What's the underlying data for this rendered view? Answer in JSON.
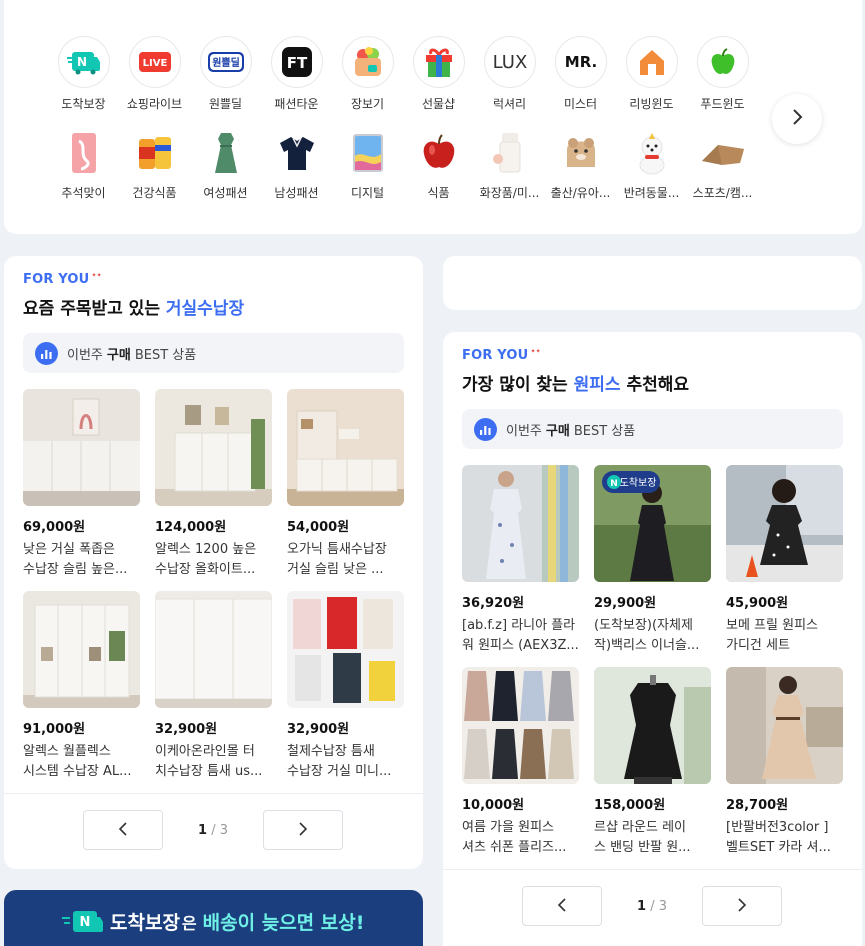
{
  "categories": {
    "row1": [
      {
        "label": "도착보장",
        "icon": "delivery-truck-icon"
      },
      {
        "label": "쇼핑라이브",
        "icon": "live-icon",
        "badge": "LIVE"
      },
      {
        "label": "원쁠딜",
        "icon": "one-plus-deal-icon",
        "badge": "원쁠딜"
      },
      {
        "label": "패션타운",
        "icon": "fashion-town-icon",
        "badge": "FT"
      },
      {
        "label": "장보기",
        "icon": "grocery-bag-icon"
      },
      {
        "label": "선물샵",
        "icon": "gift-icon"
      },
      {
        "label": "럭셔리",
        "icon": "luxury-icon",
        "badge": "LUX"
      },
      {
        "label": "미스터",
        "icon": "mister-icon",
        "badge": "MR."
      },
      {
        "label": "리빙윈도",
        "icon": "house-icon"
      },
      {
        "label": "푸드윈도",
        "icon": "apple-icon"
      }
    ],
    "row2": [
      {
        "label": "추석맞이",
        "icon": "chuseok-icon"
      },
      {
        "label": "건강식품",
        "icon": "health-food-icon"
      },
      {
        "label": "여성패션",
        "icon": "dress-icon"
      },
      {
        "label": "남성패션",
        "icon": "polo-shirt-icon"
      },
      {
        "label": "디지털",
        "icon": "tablet-icon"
      },
      {
        "label": "식품",
        "icon": "apple-food-icon"
      },
      {
        "label": "화장품/미...",
        "icon": "cosmetics-icon"
      },
      {
        "label": "출산/유아...",
        "icon": "baby-icon"
      },
      {
        "label": "반려동물...",
        "icon": "pet-icon"
      },
      {
        "label": "스포츠/캠...",
        "icon": "camping-icon"
      }
    ]
  },
  "left_panel": {
    "for_you": "FOR YOU",
    "title_pre": "요즘 주목받고 있는 ",
    "title_hl": "거실수납장",
    "best_pre": "이번주",
    "best_em": "구매",
    "best_post": "BEST 상품",
    "products": [
      {
        "price": "69,000원",
        "l1": "낮은 거실 폭좁은",
        "l2": "수납장 슬림 높은..."
      },
      {
        "price": "124,000원",
        "l1": "알렉스 1200 높은",
        "l2": "수납장 올화이트..."
      },
      {
        "price": "54,000원",
        "l1": "오가닉 틈새수납장",
        "l2": "거실 슬림 낮은 ..."
      },
      {
        "price": "91,000원",
        "l1": "알렉스 월플렉스",
        "l2": "시스템 수납장 AL..."
      },
      {
        "price": "32,900원",
        "l1": "이케아온라인몰 터",
        "l2": "치수납장 틈새 us..."
      },
      {
        "price": "32,900원",
        "l1": "철제수납장 틈새",
        "l2": "수납장 거실 미니..."
      }
    ],
    "page_current": "1",
    "page_total": "/ 3"
  },
  "right_panel": {
    "for_you": "FOR YOU",
    "title_pre": "가장 많이 찾는 ",
    "title_hl": "원피스",
    "title_post": " 추천해요",
    "best_pre": "이번주",
    "best_em": "구매",
    "best_post": "BEST 상품",
    "products": [
      {
        "price": "36,920원",
        "l1": "[ab.f.z] 라니아 플라",
        "l2": "워 원피스 (AEX3Z..."
      },
      {
        "price": "29,900원",
        "l1": "(도착보장)(자체제",
        "l2": "작)백리스 이너슬...",
        "tag": "도착보장"
      },
      {
        "price": "45,900원",
        "l1": "보메 프릴 원피스",
        "l2": "가디건 세트"
      },
      {
        "price": "10,000원",
        "l1": "여름 가을 원피스",
        "l2": "셔츠 쉬폰 플리즈..."
      },
      {
        "price": "158,000원",
        "l1": "르샵 라운드 레이",
        "l2": "스 밴딩 반팔 원..."
      },
      {
        "price": "28,700원",
        "l1": "[반팔버전3color ]",
        "l2": "벨트SET 카라 셔..."
      }
    ],
    "page_current": "1",
    "page_total": "/ 3"
  },
  "banner": {
    "brand": "도착보장",
    "mid": "은",
    "hl": "배송이 늦으면 보상!"
  },
  "colors": {
    "accent": "#3d6ef2",
    "banner": "#1b3f7e"
  }
}
